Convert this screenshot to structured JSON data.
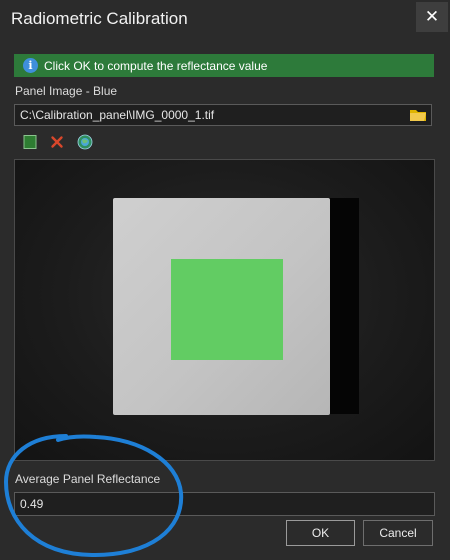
{
  "window": {
    "title": "Radiometric Calibration",
    "close_glyph": "✕"
  },
  "banner": {
    "icon": "i",
    "text": "Click OK to compute the reflectance value",
    "color": "#2d7a3a"
  },
  "panel_image": {
    "label": "Panel Image - Blue",
    "path": "C:\\Calibration_panel\\IMG_0000_1.tif"
  },
  "toolbar": {
    "icons": [
      "green-square-icon",
      "delete-x-icon",
      "globe-icon"
    ]
  },
  "result": {
    "label": "Average Panel Reflectance",
    "value": "0.49"
  },
  "buttons": {
    "ok": "OK",
    "cancel": "Cancel"
  },
  "colors": {
    "roi": "#62cc63",
    "annotation": "#1e7fd6",
    "banner": "#2d7a3a"
  }
}
